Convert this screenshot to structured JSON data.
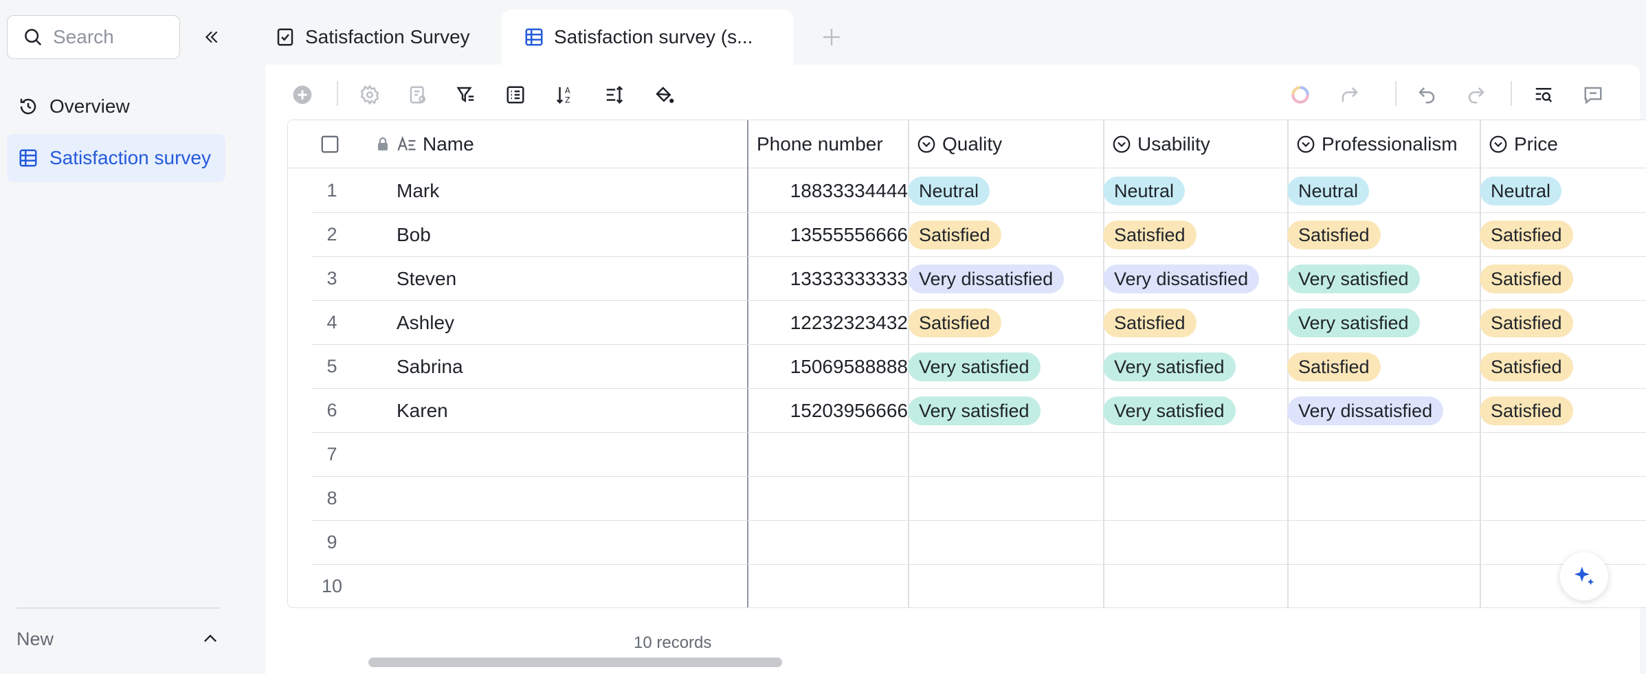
{
  "sidebar": {
    "search_placeholder": "Search",
    "items": [
      {
        "label": "Overview",
        "icon": "clock-icon"
      },
      {
        "label": "Satisfaction survey",
        "icon": "table-icon"
      }
    ],
    "new_label": "New"
  },
  "tabs": [
    {
      "label": "Satisfaction Survey",
      "icon": "form-check-icon"
    },
    {
      "label": "Satisfaction survey (s...",
      "icon": "table-icon"
    }
  ],
  "colors": {
    "accent": "#245bdb",
    "tag_neutral": "#c6ebf5",
    "tag_satisfied": "#fbe6b7",
    "tag_very_satisfied": "#c2ede4",
    "tag_very_dissatisfied": "#dde3fb"
  },
  "table": {
    "columns": {
      "name": "Name",
      "phone": "Phone number",
      "quality": "Quality",
      "usability": "Usability",
      "professionalism": "Professionalism",
      "price": "Price"
    },
    "rows": [
      {
        "num": "1",
        "name": "Mark",
        "phone": "18833334444",
        "quality": "Neutral",
        "usability": "Neutral",
        "professionalism": "Neutral",
        "price": "Neutral"
      },
      {
        "num": "2",
        "name": "Bob",
        "phone": "13555556666",
        "quality": "Satisfied",
        "usability": "Satisfied",
        "professionalism": "Satisfied",
        "price": "Satisfied"
      },
      {
        "num": "3",
        "name": "Steven",
        "phone": "13333333333",
        "quality": "Very dissatisfied",
        "usability": "Very dissatisfied",
        "professionalism": "Very satisfied",
        "price": "Satisfied"
      },
      {
        "num": "4",
        "name": "Ashley",
        "phone": "12232323432",
        "quality": "Satisfied",
        "usability": "Satisfied",
        "professionalism": "Very satisfied",
        "price": "Satisfied"
      },
      {
        "num": "5",
        "name": "Sabrina",
        "phone": "15069588888",
        "quality": "Very satisfied",
        "usability": "Very satisfied",
        "professionalism": "Satisfied",
        "price": "Satisfied"
      },
      {
        "num": "6",
        "name": "Karen",
        "phone": "15203956666",
        "quality": "Very satisfied",
        "usability": "Very satisfied",
        "professionalism": "Very dissatisfied",
        "price": "Satisfied"
      },
      {
        "num": "7",
        "name": "",
        "phone": "",
        "quality": "",
        "usability": "",
        "professionalism": "",
        "price": ""
      },
      {
        "num": "8",
        "name": "",
        "phone": "",
        "quality": "",
        "usability": "",
        "professionalism": "",
        "price": ""
      },
      {
        "num": "9",
        "name": "",
        "phone": "",
        "quality": "",
        "usability": "",
        "professionalism": "",
        "price": ""
      },
      {
        "num": "10",
        "name": "",
        "phone": "",
        "quality": "",
        "usability": "",
        "professionalism": "",
        "price": ""
      }
    ]
  },
  "footer": {
    "records": "10 records"
  }
}
